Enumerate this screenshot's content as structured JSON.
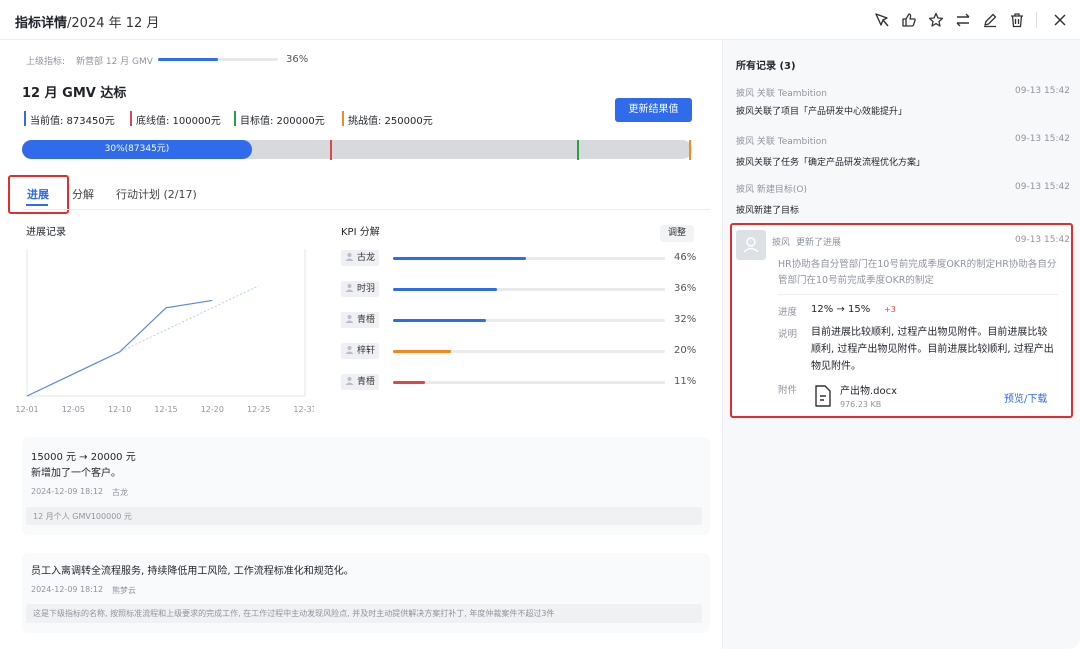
{
  "header": {
    "title": "指标详情",
    "subtitle": "/2024 年 12 月"
  },
  "parent": {
    "label": "上级指标:",
    "name": "新营部 12 月 GMV",
    "percent": "36%",
    "progress": 0.36
  },
  "metric": {
    "title": "12 月 GMV 达标",
    "update_button": "更新结果值",
    "values": [
      {
        "label": "当前值: 873450元",
        "color": "#2f6bea"
      },
      {
        "label": "底线值: 100000元",
        "color": "#e0454a"
      },
      {
        "label": "目标值: 200000元",
        "color": "#29a046"
      },
      {
        "label": "挑战值: 250000元",
        "color": "#f08c1f"
      }
    ],
    "progress_label": "30%(87345元)",
    "progress": 0.3
  },
  "tabs": [
    {
      "label": "进展"
    },
    {
      "label": "分解"
    },
    {
      "label": "行动计划 (2/17)"
    }
  ],
  "progress_chart": {
    "title": "进展记录",
    "chart_data": {
      "type": "line",
      "x": [
        "12-01",
        "12-05",
        "12-10",
        "12-15",
        "12-20",
        "12-25",
        "12-31"
      ],
      "series": [
        {
          "values": [
            0,
            6,
            12,
            24,
            26,
            null,
            null
          ]
        }
      ]
    }
  },
  "kpi": {
    "title": "KPI 分解",
    "adjust": "调整",
    "rows": [
      {
        "name": "古龙",
        "pct": "46%",
        "value": 0.46,
        "color": "#2f6bea"
      },
      {
        "name": "时羽",
        "pct": "36%",
        "value": 0.36,
        "color": "#2f6bea"
      },
      {
        "name": "青梧",
        "pct": "32%",
        "value": 0.32,
        "color": "#2f6bea"
      },
      {
        "name": "梓轩",
        "pct": "20%",
        "value": 0.2,
        "color": "#f08c1f"
      },
      {
        "name": "青梧",
        "pct": "11%",
        "value": 0.11,
        "color": "#e0454a"
      }
    ]
  },
  "updates": [
    {
      "change": "15000 元 → 20000 元",
      "desc": "新增加了一个客户。",
      "time": "2024-12-09 18:12",
      "user": "古龙",
      "note": "12 月个人 GMV100000 元"
    },
    {
      "change": "",
      "desc": "员工入离调转全流程服务, 持续降低用工风险, 工作流程标准化和规范化。",
      "time": "2024-12-09 18:12",
      "user": "熊梦云",
      "note": "这是下级指标的名称, 按照标准流程和上级要求的完成工作, 在工作过程中主动发现风险点, 并及时主动提供解决方案打补丁, 年度仲裁案件不超过3件"
    }
  ],
  "records": {
    "title": "所有记录 (3)",
    "items": [
      {
        "meta": "披风 关联 Teambition",
        "time": "09-13 15:42",
        "text": "披风关联了项目「产品研发中心效能提升」"
      },
      {
        "meta": "披风 关联 Teambition",
        "time": "09-13 15:42",
        "text": "披风关联了任务「确定产品研发流程优化方案」"
      },
      {
        "meta": "披风 新建目标(O)",
        "time": "09-13 15:42",
        "text": "披风新建了目标"
      }
    ],
    "detail": {
      "user": "披风",
      "action": "更新了进展",
      "time": "09-13 15:42",
      "objective": "HR协助各自分管部门在10号前完成季度OKR的制定HR协助各自分管部门在10号前完成季度OKR的制定",
      "progress_label": "进度",
      "progress_change": "12% → 15%",
      "delta": "+3",
      "desc_label": "说明",
      "desc": "目前进展比较顺利, 过程产出物见附件。目前进展比较顺利, 过程产出物见附件。目前进展比较顺利, 过程产出物见附件。",
      "attach_label": "附件",
      "file_name": "产出物.docx",
      "file_size": "976.23 KB",
      "download": "预览/下载"
    }
  }
}
